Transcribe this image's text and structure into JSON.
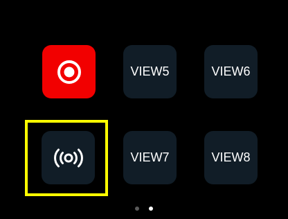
{
  "tiles": {
    "record": {
      "icon": "record-icon",
      "color": "#f20000"
    },
    "broadcast": {
      "icon": "broadcast-icon"
    },
    "view5": {
      "label": "VIEW5"
    },
    "view6": {
      "label": "VIEW6"
    },
    "view7": {
      "label": "VIEW7"
    },
    "view8": {
      "label": "VIEW8"
    }
  },
  "selection": {
    "tile": "broadcast",
    "color": "#ffff00"
  },
  "pager": {
    "page_count": 2,
    "active_page": 2
  },
  "colors": {
    "background": "#000000",
    "tile": "#111d27",
    "text": "#ffffff"
  }
}
